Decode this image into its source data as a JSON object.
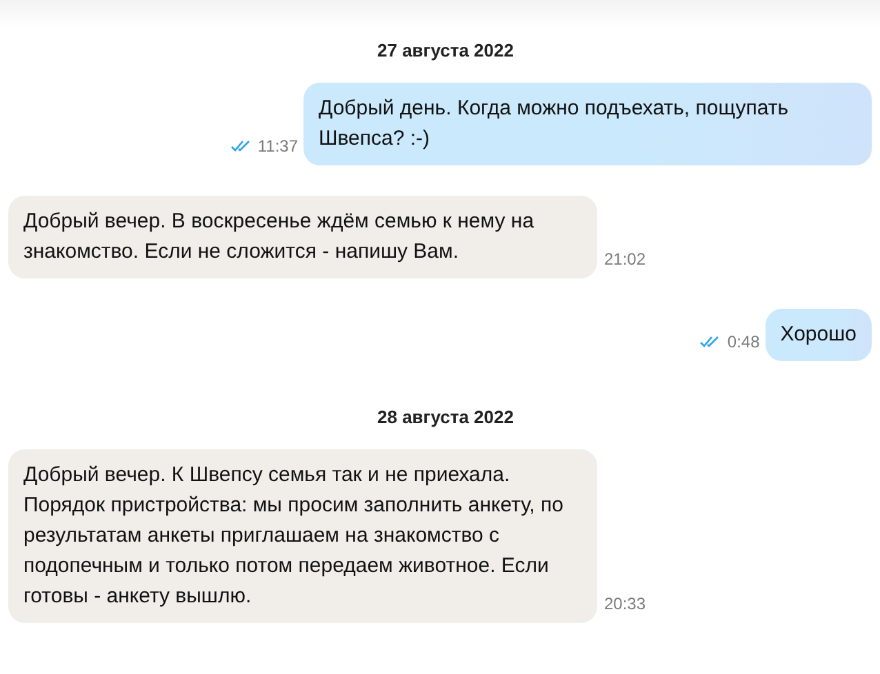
{
  "messages": [
    {
      "kind": "date",
      "text": "27 августа 2022"
    },
    {
      "kind": "out",
      "text": "Добрый день. Когда можно подъехать, пощупать Швепса? :-)",
      "time": "11:37",
      "read": true
    },
    {
      "kind": "in",
      "text": "Добрый вечер. В воскресенье ждём семью к нему на знакомство. Если не сложится - напишу Вам.",
      "time": "21:02"
    },
    {
      "kind": "out",
      "text": "Хорошо",
      "time": "0:48",
      "read": true
    },
    {
      "kind": "date",
      "text": "28 августа 2022"
    },
    {
      "kind": "in",
      "text": "Добрый вечер. К Швепсу семья так и не приехала. Порядок пристройства: мы просим заполнить анкету, по результатам анкеты приглашаем на знакомство с подопечным и только потом передаем животное. Если готовы - анкету вышлю.",
      "time": "20:33"
    }
  ]
}
